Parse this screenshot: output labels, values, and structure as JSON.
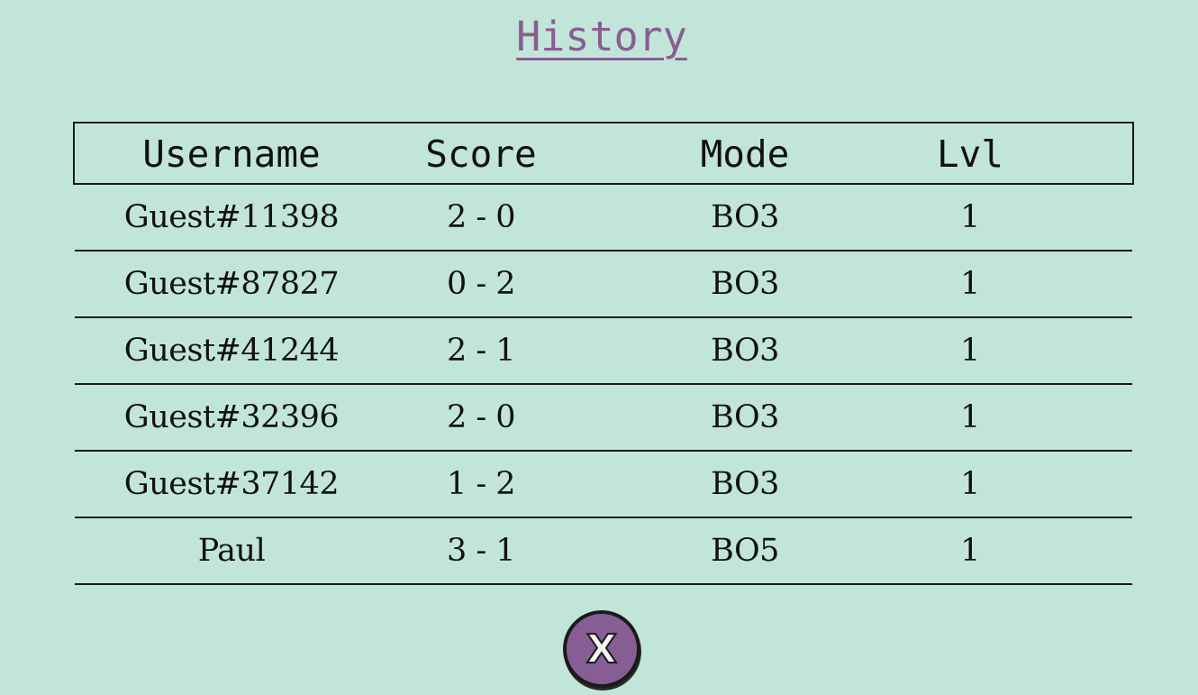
{
  "title": "History",
  "table": {
    "headers": [
      "Username",
      "Score",
      "Mode",
      "Lvl"
    ],
    "rows": [
      [
        "Guest#11398",
        "2 - 0",
        "BO3",
        "1"
      ],
      [
        "Guest#87827",
        "0 - 2",
        "BO3",
        "1"
      ],
      [
        "Guest#41244",
        "2 - 1",
        "BO3",
        "1"
      ],
      [
        "Guest#32396",
        "2 - 0",
        "BO3",
        "1"
      ],
      [
        "Guest#37142",
        "1 - 2",
        "BO3",
        "1"
      ],
      [
        "Paul",
        "3 - 1",
        "BO5",
        "1"
      ]
    ]
  },
  "close_button": {
    "label": "X",
    "icon": "close-icon",
    "color": "#875e94"
  },
  "colors": {
    "background": "#c2e5da",
    "title": "#8a5d8f",
    "text": "#111111"
  }
}
